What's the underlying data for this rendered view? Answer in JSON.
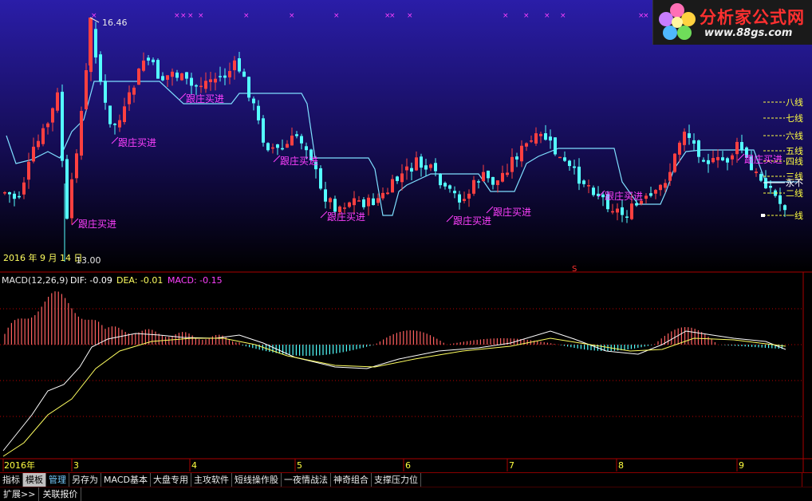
{
  "price_panel": {
    "high_label": "16.46",
    "low_label": "13.00",
    "date_label": "2016 年 9 月 14 日",
    "signal_label": "跟庄买进",
    "bottom_marker": "S"
  },
  "levels": [
    "八线",
    "七线",
    "六线",
    "五线",
    "四线",
    "三线",
    "永不",
    "二线",
    "一线"
  ],
  "macd": {
    "name": "MACD(12,26,9)",
    "dif": "DIF: -0.09",
    "dea": "DEA: -0.01",
    "macd": "MACD: -0.15"
  },
  "time_axis": [
    "2016年",
    "3",
    "4",
    "5",
    "6",
    "7",
    "8",
    "9"
  ],
  "tabs": [
    "指标",
    "模板",
    "管理",
    "另存为",
    "MACD基本",
    "大盘专用",
    "主攻软件",
    "短线操作股",
    "一夜情战法",
    "神奇组合",
    "支撑压力位"
  ],
  "ext_tabs": [
    "扩展>>",
    "关联报价"
  ],
  "logo": {
    "title": "分析家公式网",
    "url": "www.88gs.com"
  },
  "colors": {
    "up": "#ff4040",
    "down": "#54ffff",
    "signal": "#ff40ff",
    "level": "#ffff40",
    "line": "#7fdfff",
    "dif": "#ffffff",
    "dea": "#ffff60"
  }
}
